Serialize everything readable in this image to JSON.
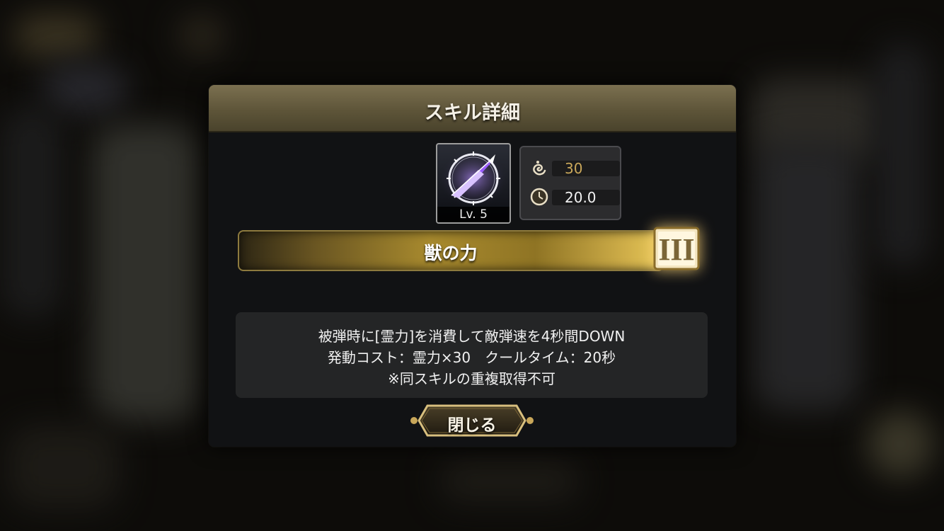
{
  "dialog": {
    "title": "スキル詳細",
    "close_label": "閉じる"
  },
  "skill": {
    "icon": "purple-arrow-skill-icon",
    "level_label": "Lv. 5",
    "name": "獣の力",
    "rank": "III",
    "cost_icon": "spirit-power-icon",
    "cost": "30",
    "cooldown_icon": "clock-icon",
    "cooldown": "20.0",
    "description": [
      "被弾時に[霊力]を消費して敵弾速を4秒間DOWN",
      "発動コスト：霊力×30　クールタイム：20秒",
      "※同スキルの重複取得不可"
    ]
  },
  "colors": {
    "header_gold": "#6b6244",
    "accent_gold": "#c9a75a",
    "panel_dark": "#111214"
  }
}
